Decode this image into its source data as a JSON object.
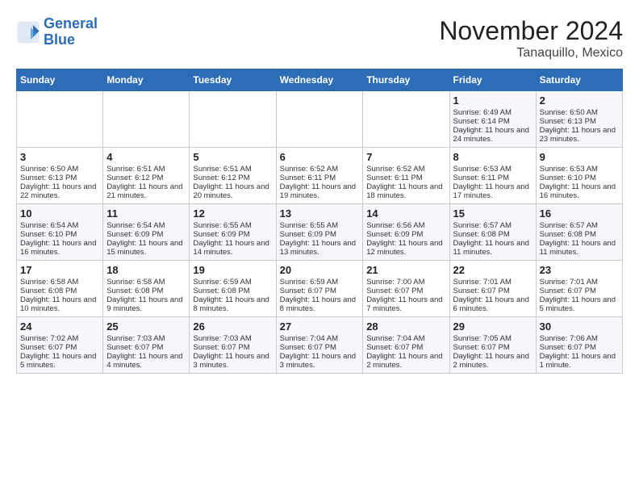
{
  "header": {
    "logo_line1": "General",
    "logo_line2": "Blue",
    "month": "November 2024",
    "location": "Tanaquillo, Mexico"
  },
  "weekdays": [
    "Sunday",
    "Monday",
    "Tuesday",
    "Wednesday",
    "Thursday",
    "Friday",
    "Saturday"
  ],
  "weeks": [
    [
      {
        "day": "",
        "info": ""
      },
      {
        "day": "",
        "info": ""
      },
      {
        "day": "",
        "info": ""
      },
      {
        "day": "",
        "info": ""
      },
      {
        "day": "",
        "info": ""
      },
      {
        "day": "1",
        "info": "Sunrise: 6:49 AM\nSunset: 6:14 PM\nDaylight: 11 hours and 24 minutes."
      },
      {
        "day": "2",
        "info": "Sunrise: 6:50 AM\nSunset: 6:13 PM\nDaylight: 11 hours and 23 minutes."
      }
    ],
    [
      {
        "day": "3",
        "info": "Sunrise: 6:50 AM\nSunset: 6:13 PM\nDaylight: 11 hours and 22 minutes."
      },
      {
        "day": "4",
        "info": "Sunrise: 6:51 AM\nSunset: 6:12 PM\nDaylight: 11 hours and 21 minutes."
      },
      {
        "day": "5",
        "info": "Sunrise: 6:51 AM\nSunset: 6:12 PM\nDaylight: 11 hours and 20 minutes."
      },
      {
        "day": "6",
        "info": "Sunrise: 6:52 AM\nSunset: 6:11 PM\nDaylight: 11 hours and 19 minutes."
      },
      {
        "day": "7",
        "info": "Sunrise: 6:52 AM\nSunset: 6:11 PM\nDaylight: 11 hours and 18 minutes."
      },
      {
        "day": "8",
        "info": "Sunrise: 6:53 AM\nSunset: 6:11 PM\nDaylight: 11 hours and 17 minutes."
      },
      {
        "day": "9",
        "info": "Sunrise: 6:53 AM\nSunset: 6:10 PM\nDaylight: 11 hours and 16 minutes."
      }
    ],
    [
      {
        "day": "10",
        "info": "Sunrise: 6:54 AM\nSunset: 6:10 PM\nDaylight: 11 hours and 16 minutes."
      },
      {
        "day": "11",
        "info": "Sunrise: 6:54 AM\nSunset: 6:09 PM\nDaylight: 11 hours and 15 minutes."
      },
      {
        "day": "12",
        "info": "Sunrise: 6:55 AM\nSunset: 6:09 PM\nDaylight: 11 hours and 14 minutes."
      },
      {
        "day": "13",
        "info": "Sunrise: 6:55 AM\nSunset: 6:09 PM\nDaylight: 11 hours and 13 minutes."
      },
      {
        "day": "14",
        "info": "Sunrise: 6:56 AM\nSunset: 6:09 PM\nDaylight: 11 hours and 12 minutes."
      },
      {
        "day": "15",
        "info": "Sunrise: 6:57 AM\nSunset: 6:08 PM\nDaylight: 11 hours and 11 minutes."
      },
      {
        "day": "16",
        "info": "Sunrise: 6:57 AM\nSunset: 6:08 PM\nDaylight: 11 hours and 11 minutes."
      }
    ],
    [
      {
        "day": "17",
        "info": "Sunrise: 6:58 AM\nSunset: 6:08 PM\nDaylight: 11 hours and 10 minutes."
      },
      {
        "day": "18",
        "info": "Sunrise: 6:58 AM\nSunset: 6:08 PM\nDaylight: 11 hours and 9 minutes."
      },
      {
        "day": "19",
        "info": "Sunrise: 6:59 AM\nSunset: 6:08 PM\nDaylight: 11 hours and 8 minutes."
      },
      {
        "day": "20",
        "info": "Sunrise: 6:59 AM\nSunset: 6:07 PM\nDaylight: 11 hours and 8 minutes."
      },
      {
        "day": "21",
        "info": "Sunrise: 7:00 AM\nSunset: 6:07 PM\nDaylight: 11 hours and 7 minutes."
      },
      {
        "day": "22",
        "info": "Sunrise: 7:01 AM\nSunset: 6:07 PM\nDaylight: 11 hours and 6 minutes."
      },
      {
        "day": "23",
        "info": "Sunrise: 7:01 AM\nSunset: 6:07 PM\nDaylight: 11 hours and 5 minutes."
      }
    ],
    [
      {
        "day": "24",
        "info": "Sunrise: 7:02 AM\nSunset: 6:07 PM\nDaylight: 11 hours and 5 minutes."
      },
      {
        "day": "25",
        "info": "Sunrise: 7:03 AM\nSunset: 6:07 PM\nDaylight: 11 hours and 4 minutes."
      },
      {
        "day": "26",
        "info": "Sunrise: 7:03 AM\nSunset: 6:07 PM\nDaylight: 11 hours and 3 minutes."
      },
      {
        "day": "27",
        "info": "Sunrise: 7:04 AM\nSunset: 6:07 PM\nDaylight: 11 hours and 3 minutes."
      },
      {
        "day": "28",
        "info": "Sunrise: 7:04 AM\nSunset: 6:07 PM\nDaylight: 11 hours and 2 minutes."
      },
      {
        "day": "29",
        "info": "Sunrise: 7:05 AM\nSunset: 6:07 PM\nDaylight: 11 hours and 2 minutes."
      },
      {
        "day": "30",
        "info": "Sunrise: 7:06 AM\nSunset: 6:07 PM\nDaylight: 11 hours and 1 minute."
      }
    ]
  ]
}
